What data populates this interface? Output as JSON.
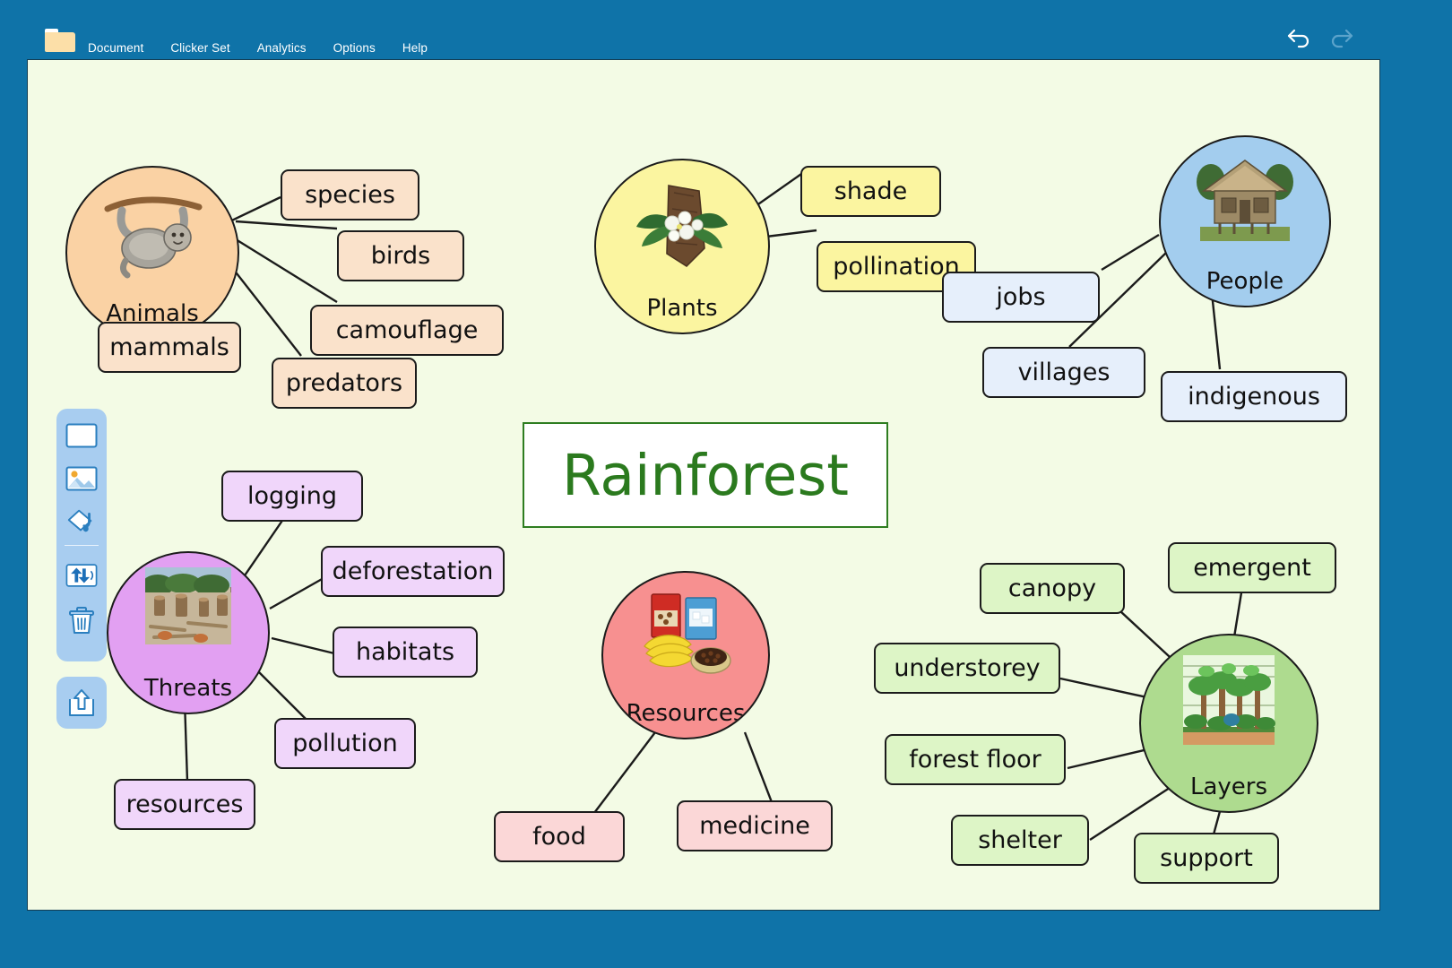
{
  "window": {
    "frame_color": "#0f73a8",
    "canvas_color": "#f3fbe5"
  },
  "menubar": {
    "folder_icon": "folder-icon",
    "items": [
      {
        "label": "Document"
      },
      {
        "label": "Clicker Set"
      },
      {
        "label": "Analytics"
      },
      {
        "label": "Options"
      },
      {
        "label": "Help"
      }
    ],
    "undo_label": "undo-icon",
    "redo_label": "redo-icon"
  },
  "toolbar": {
    "panel_color": "#a8cdf0",
    "tools": [
      {
        "name": "blank-card-tool",
        "icon": "blank-card-icon"
      },
      {
        "name": "picture-tool",
        "icon": "picture-icon"
      },
      {
        "name": "paint-fill-tool",
        "icon": "paint-bucket-icon"
      },
      {
        "name": "swap-direction-tool",
        "icon": "swap-arrows-icon"
      },
      {
        "name": "delete-tool",
        "icon": "trash-icon"
      },
      {
        "name": "share-tool",
        "icon": "share-upload-icon"
      }
    ]
  },
  "mindmap": {
    "title": "Rainforest",
    "title_color": "#2b7a1e",
    "nodes": [
      {
        "id": "animals",
        "label": "Animals",
        "color": "#fad2a4",
        "art": "sloth-illustration"
      },
      {
        "id": "plants",
        "label": "Plants",
        "color": "#fbf5a0",
        "art": "orchid-on-bark-illustration"
      },
      {
        "id": "people",
        "label": "People",
        "color": "#a3cdee",
        "art": "stilt-hut-illustration"
      },
      {
        "id": "threats",
        "label": "Threats",
        "color": "#e2a0f2",
        "art": "deforestation-photo"
      },
      {
        "id": "resources",
        "label": "Resources",
        "color": "#f79090",
        "art": "groceries-illustration"
      },
      {
        "id": "layers",
        "label": "Layers",
        "color": "#aedb8f",
        "art": "forest-layers-illustration"
      }
    ],
    "chips": [
      {
        "text": "species",
        "group": "animals",
        "color": "#fae2cb"
      },
      {
        "text": "birds",
        "group": "animals",
        "color": "#fae2cb"
      },
      {
        "text": "camouflage",
        "group": "animals",
        "color": "#fae2cb"
      },
      {
        "text": "predators",
        "group": "animals",
        "color": "#fae2cb"
      },
      {
        "text": "mammals",
        "group": "animals",
        "color": "#fae2cb"
      },
      {
        "text": "shade",
        "group": "plants",
        "color": "#fbf5a0"
      },
      {
        "text": "pollination",
        "group": "plants",
        "color": "#fbf5a0"
      },
      {
        "text": "jobs",
        "group": "people",
        "color": "#e6effb"
      },
      {
        "text": "villages",
        "group": "people",
        "color": "#e6effb"
      },
      {
        "text": "indigenous",
        "group": "people",
        "color": "#e6effb"
      },
      {
        "text": "logging",
        "group": "threats",
        "color": "#f0d6fa"
      },
      {
        "text": "deforestation",
        "group": "threats",
        "color": "#f0d6fa"
      },
      {
        "text": "habitats",
        "group": "threats",
        "color": "#f0d6fa"
      },
      {
        "text": "pollution",
        "group": "threats",
        "color": "#f0d6fa"
      },
      {
        "text": "resources",
        "group": "threats",
        "color": "#f0d6fa"
      },
      {
        "text": "food",
        "group": "resources",
        "color": "#fbd7d7"
      },
      {
        "text": "medicine",
        "group": "resources",
        "color": "#fbd7d7"
      },
      {
        "text": "canopy",
        "group": "layers",
        "color": "#ddf5c6"
      },
      {
        "text": "emergent",
        "group": "layers",
        "color": "#ddf5c6"
      },
      {
        "text": "understorey",
        "group": "layers",
        "color": "#ddf5c6"
      },
      {
        "text": "forest floor",
        "group": "layers",
        "color": "#ddf5c6"
      },
      {
        "text": "shelter",
        "group": "layers",
        "color": "#ddf5c6"
      },
      {
        "text": "support",
        "group": "layers",
        "color": "#ddf5c6"
      }
    ]
  }
}
